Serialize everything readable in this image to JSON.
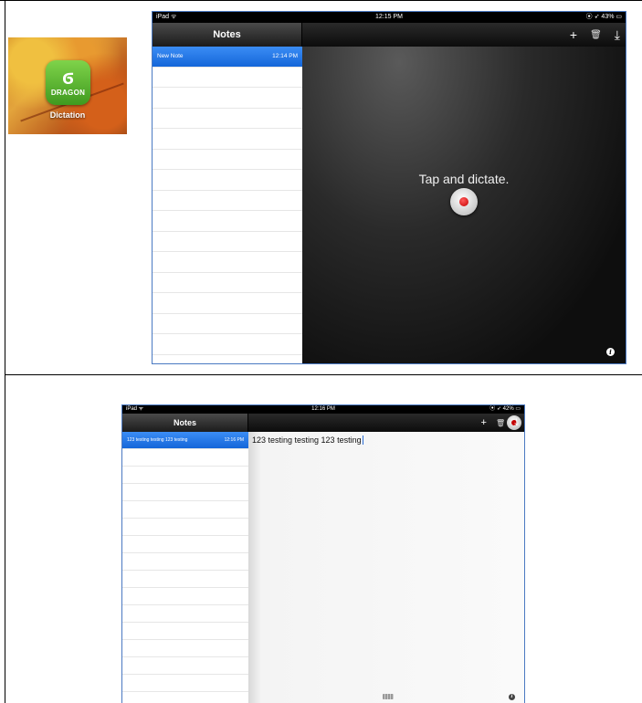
{
  "app_icon": {
    "logo_glyph": "ϭ",
    "logo_word": "DRAGON",
    "label": "Dictation",
    "colors": {
      "icon_green": "#5bb832"
    }
  },
  "screen1": {
    "status": {
      "device": "iPad ᯤ",
      "time": "12:15 PM",
      "battery": "⦿ ➶ 43% ▭"
    },
    "nav": {
      "title": "Notes",
      "icons": [
        "plus-icon",
        "trash-icon",
        "export-icon"
      ],
      "plus": "+",
      "trash": "🗑",
      "export": "⤓"
    },
    "notes": [
      {
        "title": "New Note",
        "time": "12:14 PM"
      }
    ],
    "dictation_prompt": "Tap and dictate.",
    "info": "i"
  },
  "screen2": {
    "status": {
      "device": "iPad ᯤ",
      "time": "12:16 PM",
      "battery": "⦿ ➶ 42% ▭"
    },
    "nav": {
      "title": "Notes",
      "plus": "+",
      "trash": "🗑",
      "export": "⤓"
    },
    "notes": [
      {
        "title": "123 testing testing 123 testing",
        "time": "12:16 PM"
      }
    ],
    "editor_text": "123 testing testing 123 testing",
    "info": "i"
  },
  "colors": {
    "accent_blue": "#1466d9",
    "border_blue": "#4a79c2",
    "record_red": "#c40000"
  }
}
